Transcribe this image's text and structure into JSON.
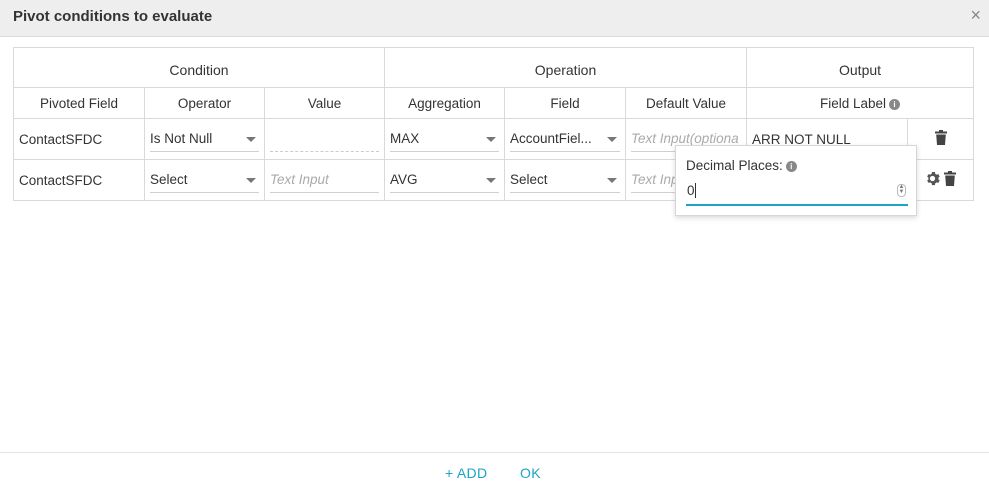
{
  "dialog": {
    "title": "Pivot conditions to evaluate",
    "close_glyph": "×"
  },
  "table": {
    "groups": [
      {
        "label": "Condition",
        "span": 3
      },
      {
        "label": "Operation",
        "span": 3
      },
      {
        "label": "Output",
        "span": 2
      }
    ],
    "columns": {
      "pivoted_field": "Pivoted Field",
      "operator": "Operator",
      "value": "Value",
      "aggregation": "Aggregation",
      "field": "Field",
      "default_value": "Default Value",
      "field_label": "Field Label"
    },
    "rows": [
      {
        "pivoted_field": "ContactSFDC",
        "operator": "Is Not Null",
        "value": "",
        "aggregation": "MAX",
        "field": "AccountFiel...",
        "default_value_placeholder": "Text Input(optiona",
        "field_label": "ARR NOT NULL"
      },
      {
        "pivoted_field": "ContactSFDC",
        "operator": "Select",
        "value_placeholder": "Text Input",
        "aggregation": "AVG",
        "field": "Select",
        "default_value_placeholder": "Text Inp"
      }
    ]
  },
  "popover": {
    "label": "Decimal Places:",
    "value": "0",
    "spinner_up": "▲",
    "spinner_down": "▼"
  },
  "footer": {
    "add_label": "+ ADD",
    "ok_label": "OK"
  },
  "colors": {
    "accent": "#1aa5c7",
    "header_bg": "#eeeeee",
    "border": "#d9d9d9"
  },
  "icons": {
    "info": "i"
  }
}
